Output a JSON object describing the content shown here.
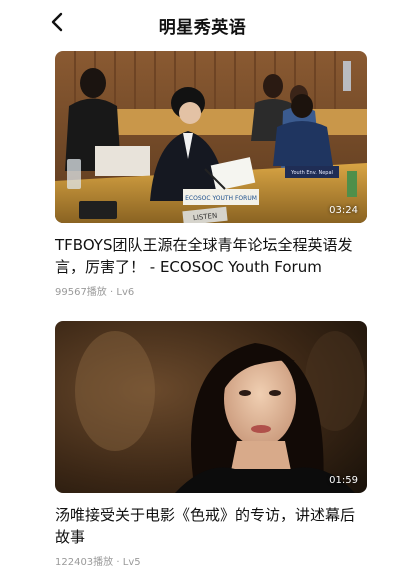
{
  "header": {
    "title": "明星秀英语",
    "back_icon": "chevron-left-icon"
  },
  "videos": [
    {
      "duration": "03:24",
      "title": "TFBOYS团队王源在全球青年论坛全程英语发言，厉害了！ - ECOSOC Youth Forum",
      "views": "99567播放",
      "separator": "·",
      "level": "Lv6",
      "podium_sign": "ECOSOC YOUTH FORUM",
      "nameplate": "Youth Env. Nepal",
      "listen_label": "LISTEN"
    },
    {
      "duration": "01:59",
      "title": "汤唯接受关于电影《色戒》的专访，讲述幕后故事",
      "views": "122403播放",
      "separator": "·",
      "level": "Lv5"
    }
  ],
  "colors": {
    "text_primary": "#111111",
    "text_meta": "#9a9a9a",
    "background": "#ffffff"
  }
}
